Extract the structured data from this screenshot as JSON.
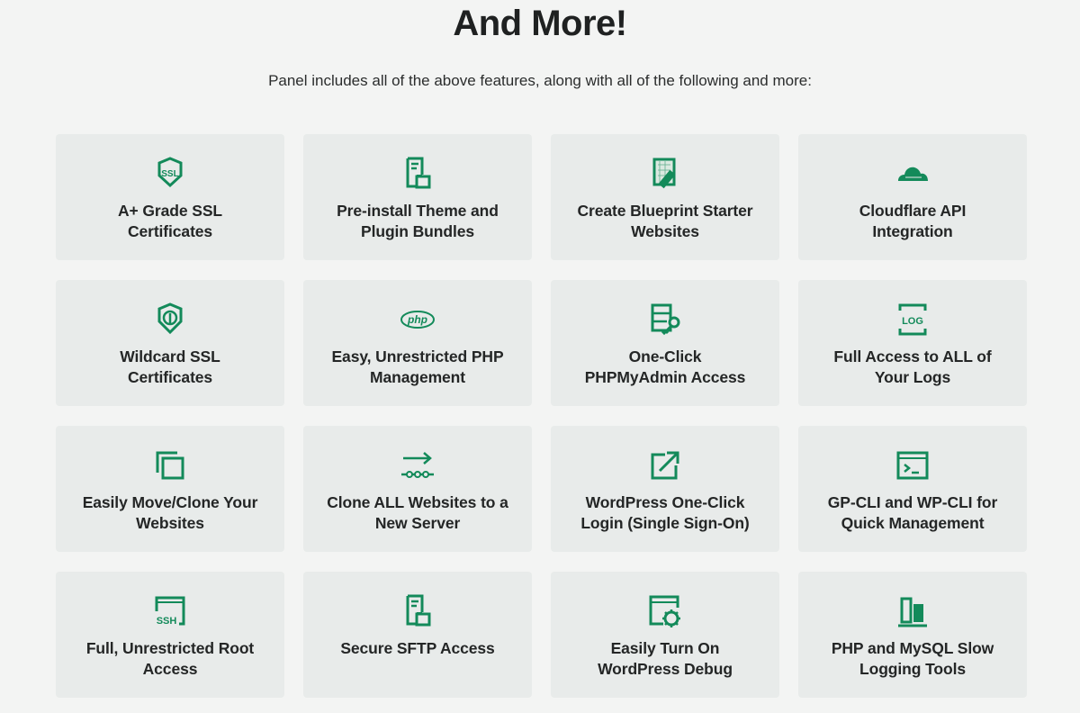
{
  "header": {
    "title": "And More!",
    "subtitle": "Panel includes all of the above features, along with all of the following and more:"
  },
  "accent_color": "#138a5a",
  "features": [
    {
      "icon": "ssl-shield-icon",
      "line1": "A+ Grade SSL",
      "line2": "Certificates"
    },
    {
      "icon": "document-folder-icon",
      "line1": "Pre-install Theme and",
      "line2": "Plugin Bundles"
    },
    {
      "icon": "blueprint-ruler-icon",
      "line1": "Create Blueprint Starter",
      "line2": "Websites"
    },
    {
      "icon": "cloudflare-cloud-icon",
      "line1": "Cloudflare API",
      "line2": "Integration"
    },
    {
      "icon": "wildcard-shield-icon",
      "line1": "Wildcard SSL",
      "line2": "Certificates"
    },
    {
      "icon": "php-icon",
      "line1": "Easy, Unrestricted PHP",
      "line2": "Management"
    },
    {
      "icon": "database-key-icon",
      "line1": "One-Click",
      "line2": "PHPMyAdmin Access"
    },
    {
      "icon": "log-icon",
      "line1": "Full Access to ALL of",
      "line2": "Your Logs"
    },
    {
      "icon": "clone-icon",
      "line1": "Easily Move/Clone Your",
      "line2": "Websites"
    },
    {
      "icon": "migrate-arrow-icon",
      "line1": "Clone ALL Websites to a",
      "line2": "New Server"
    },
    {
      "icon": "external-link-icon",
      "line1": "WordPress One-Click",
      "line2": "Login (Single Sign-On)"
    },
    {
      "icon": "terminal-icon",
      "line1": "GP-CLI and WP-CLI for",
      "line2": "Quick Management"
    },
    {
      "icon": "ssh-icon",
      "line1": "Full, Unrestricted Root",
      "line2": "Access"
    },
    {
      "icon": "document-folder-icon",
      "line1": "Secure SFTP Access",
      "line2": ""
    },
    {
      "icon": "browser-bug-icon",
      "line1": "Easily Turn On",
      "line2": "WordPress Debug"
    },
    {
      "icon": "slow-log-bars-icon",
      "line1": "PHP and MySQL Slow",
      "line2": "Logging Tools"
    }
  ]
}
